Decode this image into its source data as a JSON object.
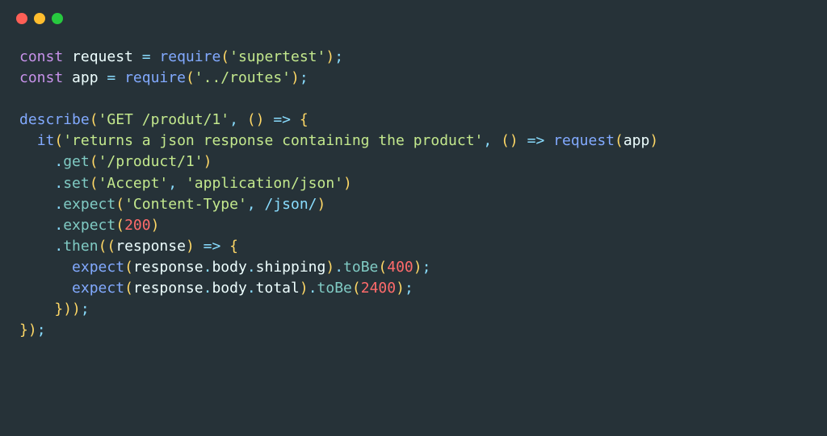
{
  "titlebar": {
    "dot1": "close",
    "dot2": "minimize",
    "dot3": "zoom"
  },
  "code": {
    "kw_const1": "const",
    "id_request": "request",
    "op_eq1": "=",
    "fn_require1": "require",
    "str_supertest": "'supertest'",
    "kw_const2": "const",
    "id_app": "app",
    "op_eq2": "=",
    "fn_require2": "require",
    "str_routes": "'../routes'",
    "fn_describe": "describe",
    "str_get_produt": "'GET /produt/1'",
    "arrow1": "=>",
    "fn_it": "it",
    "str_itdesc": "'returns a json response containing the product'",
    "arrow2": "=>",
    "fn_request_call": "request",
    "id_app_arg": "app",
    "m_get": "get",
    "str_product1": "'/product/1'",
    "m_set": "set",
    "str_accept": "'Accept'",
    "str_appjson": "'application/json'",
    "m_expect1": "expect",
    "str_ctype": "'Content-Type'",
    "re_json": "/json/",
    "m_expect2": "expect",
    "num_200": "200",
    "m_then": "then",
    "id_response": "response",
    "arrow3": "=>",
    "fn_expect_a": "expect",
    "id_resp_a": "response",
    "id_body_a": "body",
    "id_ship": "shipping",
    "m_toBe_a": "toBe",
    "num_400": "400",
    "fn_expect_b": "expect",
    "id_resp_b": "response",
    "id_body_b": "body",
    "id_total": "total",
    "m_toBe_b": "toBe",
    "num_2400": "2400"
  }
}
